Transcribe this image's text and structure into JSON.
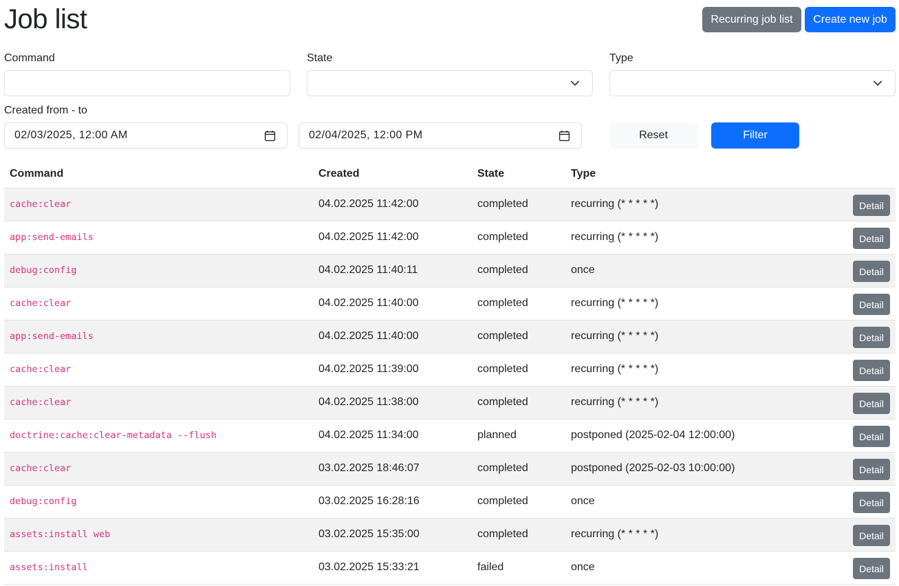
{
  "header": {
    "title": "Job list",
    "recurring_button": "Recurring job list",
    "create_button": "Create new job"
  },
  "filters": {
    "command_label": "Command",
    "command_value": "",
    "state_label": "State",
    "state_value": "",
    "type_label": "Type",
    "type_value": "",
    "created_label": "Created from - to",
    "created_from": "02/03/2025, 12:00 AM",
    "created_to": "02/04/2025, 12:00 PM",
    "reset_button": "Reset",
    "filter_button": "Filter"
  },
  "table": {
    "columns": [
      "Command",
      "Created",
      "State",
      "Type",
      ""
    ],
    "detail_label": "Detail",
    "rows": [
      {
        "command": "cache:clear",
        "created": "04.02.2025 11:42:00",
        "state": "completed",
        "type": "recurring (* * * * *)"
      },
      {
        "command": "app:send-emails",
        "created": "04.02.2025 11:42:00",
        "state": "completed",
        "type": "recurring (* * * * *)"
      },
      {
        "command": "debug:config",
        "created": "04.02.2025 11:40:11",
        "state": "completed",
        "type": "once"
      },
      {
        "command": "cache:clear",
        "created": "04.02.2025 11:40:00",
        "state": "completed",
        "type": "recurring (* * * * *)"
      },
      {
        "command": "app:send-emails",
        "created": "04.02.2025 11:40:00",
        "state": "completed",
        "type": "recurring (* * * * *)"
      },
      {
        "command": "cache:clear",
        "created": "04.02.2025 11:39:00",
        "state": "completed",
        "type": "recurring (* * * * *)"
      },
      {
        "command": "cache:clear",
        "created": "04.02.2025 11:38:00",
        "state": "completed",
        "type": "recurring (* * * * *)"
      },
      {
        "command": "doctrine:cache:clear-metadata --flush",
        "created": "04.02.2025 11:34:00",
        "state": "planned",
        "type": "postponed (2025-02-04 12:00:00)"
      },
      {
        "command": "cache:clear",
        "created": "03.02.2025 18:46:07",
        "state": "completed",
        "type": "postponed (2025-02-03 10:00:00)"
      },
      {
        "command": "debug:config",
        "created": "03.02.2025 16:28:16",
        "state": "completed",
        "type": "once"
      },
      {
        "command": "assets:install web",
        "created": "03.02.2025 15:35:00",
        "state": "completed",
        "type": "recurring (* * * * *)"
      },
      {
        "command": "assets:install",
        "created": "03.02.2025 15:33:21",
        "state": "failed",
        "type": "once"
      }
    ]
  },
  "icons": {
    "select_chevron": "chevron-down-icon",
    "date_picker": "calendar-icon"
  },
  "colors": {
    "primary": "#0d6efd",
    "secondary": "#6c757d",
    "command_text": "#d63384",
    "striped_row": "#f2f2f2"
  }
}
